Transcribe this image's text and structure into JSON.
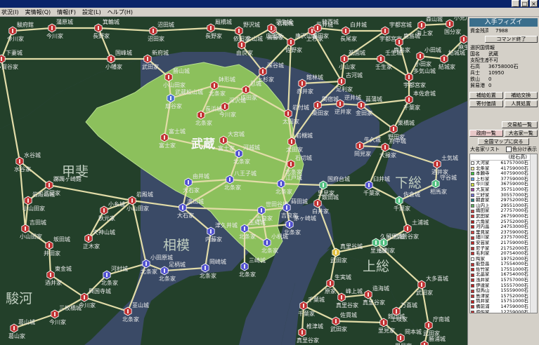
{
  "window": {
    "min": "_",
    "max": "□",
    "close": "×"
  },
  "menu": [
    "状況(I)",
    "実情報(Q)",
    "情報(F)",
    "設定(L)",
    "ヘルプ(H)"
  ],
  "map": {
    "colors": {
      "sea": "#3a4a66",
      "land": "#23402a",
      "musashi": "#8cc05c",
      "road": "#e2dca8"
    },
    "regions": [
      {
        "id": "musashi",
        "label": "武蔵"
      },
      {
        "id": "kai",
        "label": "甲斐"
      },
      {
        "id": "sagami",
        "label": "相模"
      },
      {
        "id": "suruga",
        "label": "駿河"
      },
      {
        "id": "shimousa",
        "label": "下総"
      },
      {
        "id": "kazusa",
        "label": "上総"
      }
    ],
    "castles": [
      {
        "id": "c1",
        "label": "鉢形城",
        "owner": "北条家",
        "color": "#c03030"
      },
      {
        "id": "c2",
        "label": "武蔵松山城",
        "owner": "扇谷家",
        "color": "#4a70d0"
      },
      {
        "id": "c3",
        "label": "河越城",
        "owner": "北条家",
        "color": "#5050d0"
      },
      {
        "id": "c4",
        "label": "江戸城",
        "owner": "北条家",
        "color": "#5050d0"
      },
      {
        "id": "c5",
        "label": "小田原城",
        "owner": "北条家",
        "color": "#5050d0"
      },
      {
        "id": "c6",
        "label": "国府台城",
        "owner": "里見家",
        "color": "#50c080"
      },
      {
        "id": "c7",
        "label": "岩槻城",
        "owner": "太田家",
        "color": "#c03030"
      },
      {
        "id": "c8",
        "label": "忍城",
        "owner": "成田家",
        "color": "#c03030"
      },
      {
        "id": "c9",
        "label": "滝山城",
        "owner": "大石家",
        "color": "#5050d0"
      },
      {
        "id": "c10",
        "label": "八王子城",
        "owner": "北条家",
        "color": "#5050d0"
      },
      {
        "id": "c11",
        "label": "玉縄城",
        "owner": "北条家",
        "color": "#5050d0"
      },
      {
        "id": "c12",
        "label": "久留里城",
        "owner": "里見家",
        "color": "#50c080"
      },
      {
        "id": "c13",
        "label": "真里谷城",
        "owner": "武田家",
        "color": "#e0c040"
      },
      {
        "id": "c14",
        "label": "躑躅ヶ崎館",
        "owner": "武田家",
        "color": "#c03030"
      },
      {
        "id": "c15",
        "label": "岩殿城",
        "owner": "小山田家",
        "color": "#c03030"
      },
      {
        "id": "c16",
        "label": "臼井城",
        "owner": "千葉家",
        "color": "#5050d0"
      },
      {
        "id": "c17",
        "label": "佐倉城",
        "owner": "千葉家",
        "color": "#50c080"
      },
      {
        "id": "c18",
        "label": "小弓城",
        "owner": "足利家",
        "color": "#50c080"
      },
      {
        "id": "c19",
        "label": "津久井城",
        "owner": "内藤家",
        "color": "#5050d0"
      },
      {
        "id": "c20",
        "label": "深谷城",
        "owner": "上杉家",
        "color": "#c03030"
      },
      {
        "id": "c21",
        "label": "館林城",
        "owner": "赤井家",
        "color": "#c03030"
      },
      {
        "id": "c22",
        "label": "古河城",
        "owner": "足利家",
        "color": "#c03030"
      },
      {
        "id": "c23",
        "label": "関宿城",
        "owner": "簗田家",
        "color": "#c03030"
      },
      {
        "id": "c24",
        "label": "岩付城",
        "owner": "太田家",
        "color": "#c03030"
      },
      {
        "id": "c25",
        "label": "世田谷城",
        "owner": "吉良家",
        "color": "#5050d0"
      },
      {
        "id": "c26",
        "label": "蒔田城",
        "owner": "吉良家",
        "color": "#5050d0"
      },
      {
        "id": "c27",
        "label": "三崎城",
        "owner": "北条家",
        "color": "#5050d0"
      },
      {
        "id": "c28",
        "label": "興国寺城",
        "owner": "今川家",
        "color": "#c03030"
      },
      {
        "id": "c29",
        "label": "大多喜城",
        "owner": "武田家",
        "color": "#c03030"
      },
      {
        "id": "c30",
        "label": "万喜城",
        "owner": "土岐家",
        "color": "#c03030"
      },
      {
        "id": "c31",
        "label": "土気城",
        "owner": "酒井家",
        "color": "#c03030"
      },
      {
        "id": "c32",
        "label": "本佐倉城",
        "owner": "千葉家",
        "color": "#c03030"
      },
      {
        "id": "c33",
        "label": "勝浦城",
        "owner": "正木家",
        "color": "#c03030"
      },
      {
        "id": "c34",
        "label": "沼田城",
        "owner": "沼田家",
        "color": "#c03030"
      },
      {
        "id": "c35",
        "label": "厩橋城",
        "owner": "長野家",
        "color": "#c03030"
      },
      {
        "id": "c36",
        "label": "金山城",
        "owner": "由良家",
        "color": "#c03030"
      },
      {
        "id": "c37",
        "label": "唐沢山城",
        "owner": "佐野家",
        "color": "#c03030"
      },
      {
        "id": "c38",
        "label": "宇都宮城",
        "owner": "宇都宮家",
        "color": "#c03030"
      },
      {
        "id": "c39",
        "label": "小田城",
        "owner": "小田家",
        "color": "#c03030"
      },
      {
        "id": "c40",
        "label": "結城城",
        "owner": "結城家",
        "color": "#c03030"
      },
      {
        "id": "c41",
        "label": "箕輪城",
        "owner": "長野家",
        "color": "#c03030"
      },
      {
        "id": "c42",
        "label": "国峰城",
        "owner": "小幡家",
        "color": "#c03030"
      },
      {
        "id": "c43",
        "label": "韮山城",
        "owner": "北条家",
        "color": "#c03030"
      },
      {
        "id": "c44",
        "label": "三枚橋城",
        "owner": "今川家",
        "color": "#c03030"
      },
      {
        "id": "c45",
        "label": "葛山城",
        "owner": "葛山家",
        "color": "#c03030"
      },
      {
        "id": "c46",
        "label": "吉田城",
        "owner": "小山田家",
        "color": "#c03030"
      },
      {
        "id": "c47",
        "label": "駿府館",
        "owner": "今川家",
        "color": "#c03030"
      },
      {
        "id": "c48",
        "label": "蒲原城",
        "owner": "今川家",
        "color": "#c03030"
      },
      {
        "id": "c49",
        "label": "新府城",
        "owner": "武田家",
        "color": "#c03030"
      },
      {
        "id": "c50",
        "label": "勝山城",
        "owner": "小山田家",
        "color": "#c03030"
      },
      {
        "id": "c51",
        "label": "野沢城",
        "owner": "依田家",
        "color": "#c03030"
      },
      {
        "id": "c52",
        "label": "岩櫃城",
        "owner": "斎藤家",
        "color": "#c03030"
      },
      {
        "id": "c53",
        "label": "平井城",
        "owner": "上杉家",
        "color": "#c03030"
      },
      {
        "id": "c54",
        "label": "白井城",
        "owner": "長尾家",
        "color": "#c03030"
      },
      {
        "id": "c55",
        "label": "祇園城",
        "owner": "小山家",
        "color": "#c03030"
      },
      {
        "id": "c56",
        "label": "壬生城",
        "owner": "壬生家",
        "color": "#c03030"
      },
      {
        "id": "c57",
        "label": "多気山城",
        "owner": "宇都宮家",
        "color": "#c03030"
      },
      {
        "id": "c58",
        "label": "水谷城",
        "owner": "水谷家",
        "color": "#c03030"
      },
      {
        "id": "c59",
        "label": "下妻城",
        "owner": "多賀谷家",
        "color": "#c03030"
      },
      {
        "id": "c60",
        "label": "守谷城",
        "owner": "相馬家",
        "color": "#50c080"
      },
      {
        "id": "c61",
        "label": "土浦城",
        "owner": "菅谷家",
        "color": "#c03030"
      },
      {
        "id": "c62",
        "label": "佐貫城",
        "owner": "武田家",
        "color": "#c03030"
      },
      {
        "id": "c63",
        "label": "館山城",
        "owner": "里見家",
        "color": "#c03030"
      },
      {
        "id": "c64",
        "label": "岡本城",
        "owner": "里見家",
        "color": "#c03030"
      },
      {
        "id": "c65",
        "label": "羽生城",
        "owner": "広田家",
        "color": "#c03030"
      },
      {
        "id": "c66",
        "label": "騎西城",
        "owner": "小田家",
        "color": "#c03030"
      },
      {
        "id": "c67",
        "label": "菖蒲城",
        "owner": "金田家",
        "color": "#c03030"
      },
      {
        "id": "c68",
        "label": "栗橋城",
        "owner": "野田家",
        "color": "#c03030"
      },
      {
        "id": "c69",
        "label": "逆井城",
        "owner": "逆井家",
        "color": "#c03030"
      },
      {
        "id": "c70",
        "label": "牛久城",
        "owner": "岡見家",
        "color": "#c03030"
      },
      {
        "id": "c71",
        "label": "府中城",
        "owner": "大掾家",
        "color": "#c03030"
      },
      {
        "id": "c72",
        "label": "岩殿山城",
        "owner": "小山田家",
        "color": "#c03030"
      },
      {
        "id": "c73",
        "label": "河村城",
        "owner": "北条家",
        "color": "#5050d0"
      },
      {
        "id": "c74",
        "label": "足柄城",
        "owner": "北条家",
        "color": "#5050d0"
      },
      {
        "id": "c75",
        "label": "岡崎城",
        "owner": "北条家",
        "color": "#5050d0"
      },
      {
        "id": "c76",
        "label": "小机城",
        "owner": "北条家",
        "color": "#5050d0"
      },
      {
        "id": "c77",
        "label": "茅ヶ崎城",
        "owner": "北条家",
        "color": "#5050d0"
      },
      {
        "id": "c78",
        "label": "由井城",
        "owner": "大石家",
        "color": "#5050d0"
      },
      {
        "id": "c79",
        "label": "長浜城",
        "owner": "北条家",
        "color": "#c03030"
      },
      {
        "id": "c80",
        "label": "深沢城",
        "owner": "今川家",
        "color": "#c03030"
      },
      {
        "id": "c81",
        "label": "富士城",
        "owner": "富士家",
        "color": "#c03030"
      },
      {
        "id": "c82",
        "label": "大宮城",
        "owner": "富士家",
        "color": "#c03030"
      },
      {
        "id": "c83",
        "label": "石切城",
        "owner": "北条家",
        "color": "#c03030"
      },
      {
        "id": "c84",
        "label": "飯田城",
        "owner": "白井家",
        "color": "#c03030"
      },
      {
        "id": "c85",
        "label": "千葉城",
        "owner": "千葉家",
        "color": "#c03030"
      },
      {
        "id": "c86",
        "label": "生実城",
        "owner": "原家",
        "color": "#c03030"
      },
      {
        "id": "c87",
        "label": "造海城",
        "owner": "真里谷家",
        "color": "#c03030"
      },
      {
        "id": "c88",
        "label": "峰上城",
        "owner": "真里谷家",
        "color": "#c03030"
      },
      {
        "id": "c89",
        "label": "椎津城",
        "owner": "真里谷家",
        "color": "#c03030"
      },
      {
        "id": "c90",
        "label": "庁南城",
        "owner": "武田家",
        "color": "#c03030"
      },
      {
        "id": "c91",
        "label": "小糸城",
        "owner": "秋元家",
        "color": "#c03030"
      },
      {
        "id": "c92",
        "label": "天神山城",
        "owner": "正木家",
        "color": "#c03030"
      },
      {
        "id": "c93",
        "label": "坂田城",
        "owner": "井田家",
        "color": "#c03030"
      },
      {
        "id": "c94",
        "label": "東金城",
        "owner": "酒井家",
        "color": "#c03030"
      },
      {
        "id": "c95",
        "label": "小見川城",
        "owner": "国分家",
        "color": "#c03030"
      },
      {
        "id": "c96",
        "label": "森山城",
        "owner": "海上家",
        "color": "#c03030"
      },
      {
        "id": "c97",
        "label": "鹿島城",
        "owner": "鹿島家",
        "color": "#c03030"
      },
      {
        "id": "c98",
        "label": "麻生城",
        "owner": "麻生家",
        "color": "#c03030"
      }
    ]
  },
  "panel": {
    "title": "入手フィズイ",
    "funds_label": "資金残高",
    "funds_value": "7988",
    "end_command_button": "コマンド終了",
    "selected_section": "選択国情報",
    "info": [
      {
        "k": "国名",
        "v": "武蔵"
      },
      {
        "k": "支配生産",
        "v": "不可"
      },
      {
        "k": "石高",
        "v": "36758000石"
      },
      {
        "k": "兵士",
        "v": "10950"
      },
      {
        "k": "鉄山",
        "v": "0"
      },
      {
        "k": "貿易港",
        "v": "0"
      }
    ],
    "buttons_row1": [
      "補給処置",
      "補給交換"
    ],
    "buttons_row2": [
      "寄付価請",
      "人質処置"
    ],
    "trade_button": "交易船一覧",
    "tab_country": "政府一覧",
    "tab_daimyo": "大名家一覧",
    "whole_map_button": "全国マップに戻る",
    "daimyo_list_title": "大名家リスト",
    "color_toggle_label": "色分け表示",
    "list_header": "(総石高)",
    "daimyo": [
      {
        "name": "大河家",
        "value": "61757000石",
        "color": "#ffffff"
      },
      {
        "name": "北条家",
        "value": "41759000石",
        "color": "#f0e8a0"
      },
      {
        "name": "本願寺",
        "value": "40759000石",
        "color": "#40c040"
      },
      {
        "name": "上杉家",
        "value": "37759000石",
        "color": "#60a0e0"
      },
      {
        "name": "今川家",
        "value": "36759000石",
        "color": "#d0e040"
      },
      {
        "name": "大友家",
        "value": "35751000石",
        "color": "#a040a0"
      },
      {
        "name": "三好家",
        "value": "30557000石",
        "color": "#7070d0"
      },
      {
        "name": "朝倉家",
        "value": "29752000石",
        "color": "#208080"
      },
      {
        "name": "山内上",
        "value": "29551000石",
        "color": "#60b060"
      },
      {
        "name": "織田家",
        "value": "27757000石",
        "color": "#c04040"
      },
      {
        "name": "武田家",
        "value": "26759000石",
        "color": "#d03030"
      },
      {
        "name": "六角家",
        "value": "25752000石",
        "color": "#b02020"
      },
      {
        "name": "河内畠",
        "value": "24753000石",
        "color": "#c02020"
      },
      {
        "name": "里見家",
        "value": "23759000石",
        "color": "#d04040"
      },
      {
        "name": "細川家",
        "value": "23757000石",
        "color": "#c03030"
      },
      {
        "name": "安芸家",
        "value": "21759000石",
        "color": "#c02828"
      },
      {
        "name": "尼子家",
        "value": "21752000石",
        "color": "#b83030"
      },
      {
        "name": "毛利家",
        "value": "20754000石",
        "color": "#c03030"
      },
      {
        "name": "陶家",
        "value": "19752000石",
        "color": "#ffffff"
      },
      {
        "name": "能登畠",
        "value": "17554000石",
        "color": "#c03030"
      },
      {
        "name": "佐竹家",
        "value": "17551000石",
        "color": "#c02020"
      },
      {
        "name": "北畠家",
        "value": "16754000石",
        "color": "#b02828"
      },
      {
        "name": "浅井家",
        "value": "15757000石",
        "color": "#c03030"
      },
      {
        "name": "伊達家",
        "value": "15557000石",
        "color": "#c02020"
      },
      {
        "name": "但馬山",
        "value": "15559000石",
        "color": "#b83030"
      },
      {
        "name": "島津家",
        "value": "15752000石",
        "color": "#c03030"
      },
      {
        "name": "筒井家",
        "value": "15751000石",
        "color": "#c02020"
      },
      {
        "name": "備前浦",
        "value": "14759000石",
        "color": "#c03030"
      },
      {
        "name": "遊佐家",
        "value": "12759000石",
        "color": "#c03030"
      }
    ]
  }
}
